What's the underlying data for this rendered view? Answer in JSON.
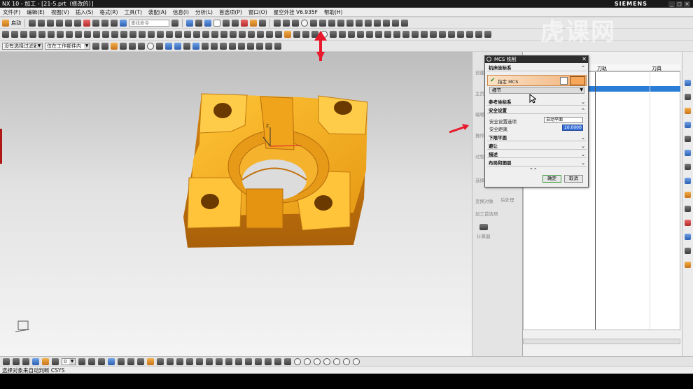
{
  "window": {
    "title": "NX 10 - 加工 - [21-5.prt（修改的）]",
    "brand": "SIEMENS"
  },
  "menu": [
    "文件(F)",
    "编辑(E)",
    "视图(V)",
    "插入(S)",
    "格式(R)",
    "工具(T)",
    "装配(A)",
    "信息(I)",
    "分析(L)",
    "首选项(P)",
    "窗口(O)",
    "星空外挂 V6.935F",
    "帮助(H)"
  ],
  "toolbar1": {
    "start_label": "启动",
    "search_placeholder": "查找命令"
  },
  "toolbar3": {
    "filter_select": "没有选择过滤器",
    "scope_select": "仅在工作部件内"
  },
  "nav_panel": {
    "labels": [
      "创建",
      "主页",
      "编辑",
      "操作",
      "过程",
      "选择",
      "变换对象",
      "后处理",
      "加工首选项",
      "计算器"
    ]
  },
  "nav_table": {
    "col_toolpath": "刀轨",
    "col_tool": "刀具"
  },
  "dialog": {
    "title": "MCS 铣削",
    "section_mcs": "机床坐标系",
    "specify_mcs": "指定 MCS",
    "detail": "细节",
    "section_ref": "参考坐标系",
    "section_safety": "安全设置",
    "safety_option_label": "安全设置选项",
    "safety_option_value": "自动平面",
    "safety_distance_label": "安全距离",
    "safety_distance_value": "10.0000",
    "section_lower": "下限平面",
    "section_avoid": "避让",
    "section_desc": "描述",
    "section_layout": "布局和图层",
    "ok": "确定",
    "cancel": "取消"
  },
  "bottom_toolbar": {
    "number_select": "0"
  },
  "status": {
    "text": "选择对象来自动判断 CSYS"
  },
  "watermark": "虎课网",
  "colors": {
    "part": "#f0a81c",
    "accent_arrow": "#e8192c",
    "dialog_highlight": "#f0b27a"
  }
}
